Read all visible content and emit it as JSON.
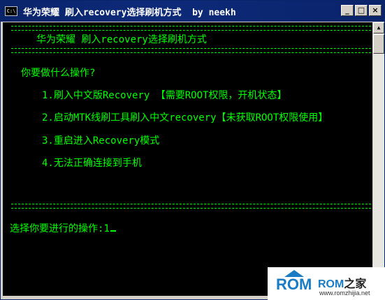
{
  "window": {
    "title": "华为荣耀 刷入recovery选择刷机方式  by neekh",
    "icon_text": "C:\\",
    "buttons": [
      "_",
      "□",
      "×"
    ]
  },
  "console": {
    "header": "华为荣耀 刷入recovery选择刷机方式",
    "question": "你要做什么操作?",
    "options": [
      "1.刷入中文版Recovery 【需要ROOT权限，开机状态】",
      "2.启动MTK线刷工具刷入中文recovery【未获取ROOT权限使用】",
      "3.重启进入Recovery模式",
      "4.无法正确连接到手机"
    ],
    "prompt": "选择你要进行的操作:",
    "input_value": "1"
  },
  "colors": {
    "text": "#00ff00",
    "background": "#000000",
    "titlebar": "#0a246a"
  },
  "watermark": {
    "logo": "ROM",
    "brand_a": "ROM",
    "brand_b": "之家",
    "url": "www.romzhijia.net"
  }
}
